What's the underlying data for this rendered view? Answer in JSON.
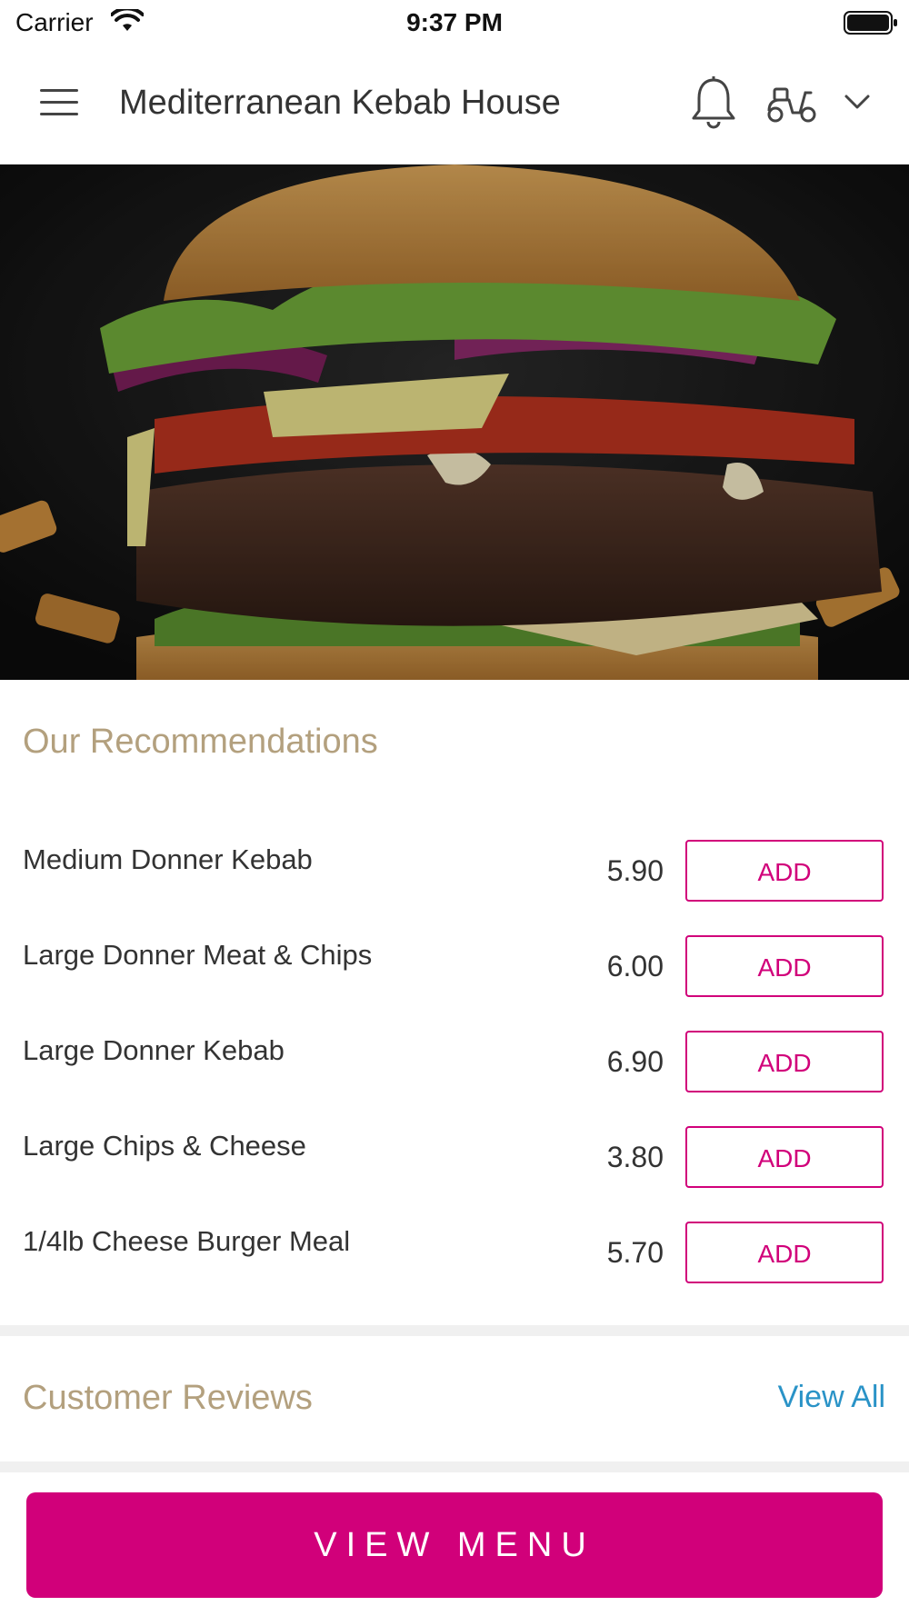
{
  "status_bar": {
    "carrier": "Carrier",
    "time": "9:37 PM",
    "icons": [
      "wifi-icon",
      "battery-icon"
    ]
  },
  "header": {
    "title": "Mediterranean Kebab House",
    "icons": [
      "menu-icon",
      "bell-icon",
      "delivery-scooter-icon",
      "chevron-down-icon"
    ]
  },
  "hero": {
    "image": "burger-photo"
  },
  "recommendations": {
    "title": "Our Recommendations",
    "add_label": "ADD",
    "items": [
      {
        "name": "Medium Donner Kebab",
        "price": "5.90"
      },
      {
        "name": "Large Donner Meat & Chips",
        "price": "6.00"
      },
      {
        "name": "Large Donner Kebab",
        "price": "6.90"
      },
      {
        "name": "Large Chips & Cheese",
        "price": "3.80"
      },
      {
        "name": "1/4lb Cheese Burger Meal",
        "price": "5.70"
      }
    ]
  },
  "reviews": {
    "title": "Customer Reviews",
    "view_all": "View All"
  },
  "footer": {
    "view_menu": "VIEW MENU"
  },
  "colors": {
    "accent": "#d1007a",
    "section_title": "#b3a07e",
    "link": "#2a93c7"
  }
}
